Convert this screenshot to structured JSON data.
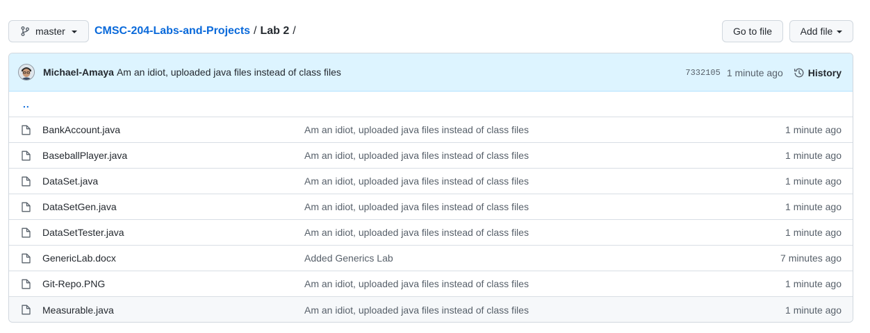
{
  "branch": {
    "icon": "git-branch-icon",
    "label": "master"
  },
  "breadcrumb": {
    "repo": "CMSC-204-Labs-and-Projects",
    "sep1": "/",
    "folder": "Lab 2",
    "sep2": "/"
  },
  "actions": {
    "go_to_file": "Go to file",
    "add_file": "Add file"
  },
  "latest_commit": {
    "author": "Michael-Amaya",
    "message": "Am an idiot, uploaded java files instead of class files",
    "sha": "7332105",
    "time": "1 minute ago",
    "history_label": "History"
  },
  "parent_dir": "..",
  "files": [
    {
      "name": "BankAccount.java",
      "message": "Am an idiot, uploaded java files instead of class files",
      "age": "1 minute ago"
    },
    {
      "name": "BaseballPlayer.java",
      "message": "Am an idiot, uploaded java files instead of class files",
      "age": "1 minute ago"
    },
    {
      "name": "DataSet.java",
      "message": "Am an idiot, uploaded java files instead of class files",
      "age": "1 minute ago"
    },
    {
      "name": "DataSetGen.java",
      "message": "Am an idiot, uploaded java files instead of class files",
      "age": "1 minute ago"
    },
    {
      "name": "DataSetTester.java",
      "message": "Am an idiot, uploaded java files instead of class files",
      "age": "1 minute ago"
    },
    {
      "name": "GenericLab.docx",
      "message": "Added Generics Lab",
      "age": "7 minutes ago"
    },
    {
      "name": "Git-Repo.PNG",
      "message": "Am an idiot, uploaded java files instead of class files",
      "age": "1 minute ago"
    },
    {
      "name": "Measurable.java",
      "message": "Am an idiot, uploaded java files instead of class files",
      "age": "1 minute ago"
    }
  ]
}
